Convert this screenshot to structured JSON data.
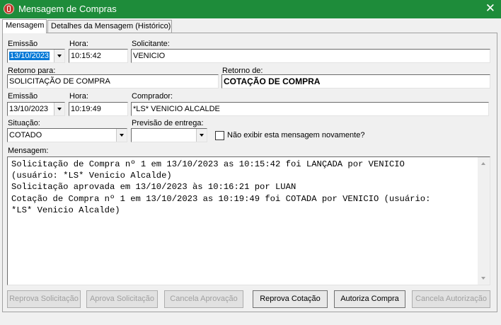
{
  "window": {
    "title": "Mensagem de Compras",
    "close_glyph": "✕"
  },
  "tabs": [
    {
      "label": "Mensagem"
    },
    {
      "label": "Detalhes da Mensagem (Histórico)"
    }
  ],
  "form": {
    "emissao1_label": "Emissão",
    "emissao1_value": "13/10/2023",
    "hora1_label": "Hora:",
    "hora1_value": "10:15:42",
    "solicitante_label": "Solicitante:",
    "solicitante_value": "VENICIO",
    "retorno_para_label": "Retorno para:",
    "retorno_para_value": "SOLICITAÇÃO DE COMPRA",
    "retorno_de_label": "Retorno de:",
    "retorno_de_value": "COTAÇÃO DE COMPRA",
    "emissao2_label": "Emissão",
    "emissao2_value": "13/10/2023",
    "hora2_label": "Hora:",
    "hora2_value": "10:19:49",
    "comprador_label": "Comprador:",
    "comprador_value": "*LS* VENICIO ALCALDE",
    "situacao_label": "Situação:",
    "situacao_value": "COTADO",
    "previsao_label": "Previsão de entrega:",
    "previsao_value": "",
    "nao_exibir_label": "Não exibir esta mensagem novamente?",
    "mensagem_label": "Mensagem:"
  },
  "message": {
    "lines": [
      "Solicitação de Compra nº 1 em 13/10/2023 as 10:15:42 foi LANÇADA por VENICIO",
      "(usuário: *LS* Venicio Alcalde)",
      "Solicitação aprovada em 13/10/2023 às 10:16:21 por LUAN",
      "Cotação de Compra nº 1 em 13/10/2023 as 10:19:49 foi COTADA por VENICIO (usuário:",
      "*LS* Venicio Alcalde)"
    ]
  },
  "buttons": [
    {
      "label": "Reprova Solicitação",
      "enabled": false
    },
    {
      "label": "Aprova Solicitação",
      "enabled": false
    },
    {
      "label": "Cancela Aprovação",
      "enabled": false
    },
    {
      "label": "Reprova Cotação",
      "enabled": true
    },
    {
      "label": "Autoriza Compra",
      "enabled": true
    },
    {
      "label": "Cancela Autorização",
      "enabled": false
    }
  ],
  "colors": {
    "titlebar": "#1e8c3a",
    "selection": "#0078d7"
  }
}
